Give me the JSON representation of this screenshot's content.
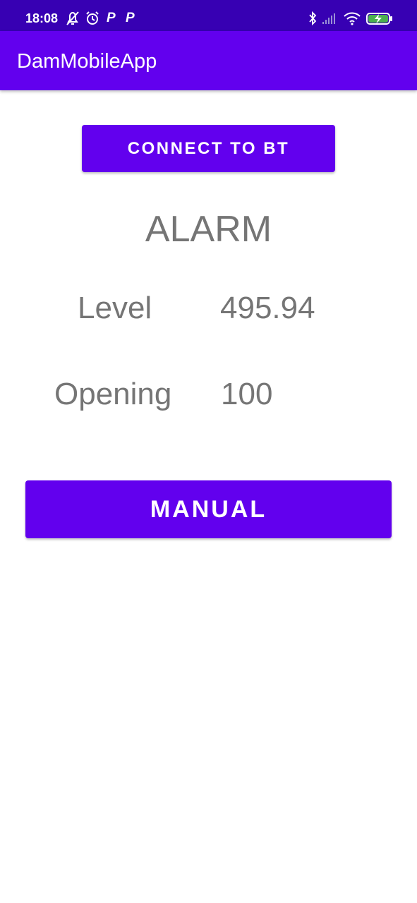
{
  "status_bar": {
    "time": "18:08",
    "left_icons": [
      "alarm-off-icon",
      "alarm-clock-icon",
      "p-icon",
      "p-icon"
    ],
    "p_glyph": "P",
    "right_icons": [
      "bluetooth-icon",
      "cellular-signal-icon",
      "wifi-icon",
      "battery-charging-icon"
    ]
  },
  "app_bar": {
    "title": "DamMobileApp"
  },
  "main": {
    "connect_button_label": "CONNECT TO BT",
    "alarm_text": "ALARM",
    "level": {
      "label": "Level",
      "value": "495.94"
    },
    "opening": {
      "label": "Opening",
      "value": "100"
    },
    "manual_button_label": "MANUAL"
  },
  "colors": {
    "status_bar": "#3700b3",
    "primary": "#6200ee",
    "text_gray": "#757575",
    "battery_fill": "#4caf50"
  }
}
